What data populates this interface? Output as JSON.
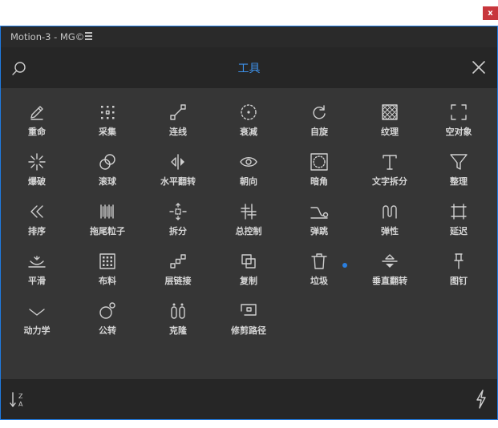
{
  "window": {
    "close_label": "x"
  },
  "panel": {
    "tab_title": "Motion-3 - MG©"
  },
  "header": {
    "title": "工具"
  },
  "tools": [
    {
      "label": "重命",
      "icon": "pencil-icon"
    },
    {
      "label": "采集",
      "icon": "dotted-grid-icon"
    },
    {
      "label": "连线",
      "icon": "connect-line-icon"
    },
    {
      "label": "衰减",
      "icon": "dotted-circle-icon"
    },
    {
      "label": "自旋",
      "icon": "rotate-icon"
    },
    {
      "label": "纹理",
      "icon": "texture-icon"
    },
    {
      "label": "空对象",
      "icon": "null-object-icon"
    },
    {
      "label": "爆破",
      "icon": "burst-icon"
    },
    {
      "label": "滚球",
      "icon": "rolling-ball-icon"
    },
    {
      "label": "水平翻转",
      "icon": "flip-horizontal-icon"
    },
    {
      "label": "朝向",
      "icon": "eye-icon"
    },
    {
      "label": "暗角",
      "icon": "vignette-icon"
    },
    {
      "label": "文字拆分",
      "icon": "text-split-icon"
    },
    {
      "label": "整理",
      "icon": "funnel-icon"
    },
    {
      "label": "排序",
      "icon": "sort-chevron-icon"
    },
    {
      "label": "拖尾粒子",
      "icon": "trail-particles-icon"
    },
    {
      "label": "拆分",
      "icon": "split-icon"
    },
    {
      "label": "总控制",
      "icon": "master-control-icon"
    },
    {
      "label": "弹跳",
      "icon": "bounce-icon"
    },
    {
      "label": "弹性",
      "icon": "elastic-icon"
    },
    {
      "label": "延迟",
      "icon": "delay-icon"
    },
    {
      "label": "平滑",
      "icon": "smooth-icon"
    },
    {
      "label": "布料",
      "icon": "cloth-icon"
    },
    {
      "label": "层链接",
      "icon": "layer-link-icon"
    },
    {
      "label": "复制",
      "icon": "duplicate-icon"
    },
    {
      "label": "垃圾",
      "icon": "trash-icon"
    },
    {
      "label": "垂直翻转",
      "icon": "flip-vertical-icon"
    },
    {
      "label": "图钉",
      "icon": "pin-icon"
    },
    {
      "label": "动力学",
      "icon": "dynamics-icon"
    },
    {
      "label": "公转",
      "icon": "revolution-icon"
    },
    {
      "label": "克隆",
      "icon": "clone-icon"
    },
    {
      "label": "修剪路径",
      "icon": "trim-path-icon"
    }
  ],
  "footer": {
    "sort_icon": "sort-za-icon",
    "action_icon": "lightning-icon"
  },
  "colors": {
    "accent": "#3d8fe6",
    "close_red": "#c8363c",
    "grid_bg": "#363636",
    "bar_bg": "#262626"
  }
}
